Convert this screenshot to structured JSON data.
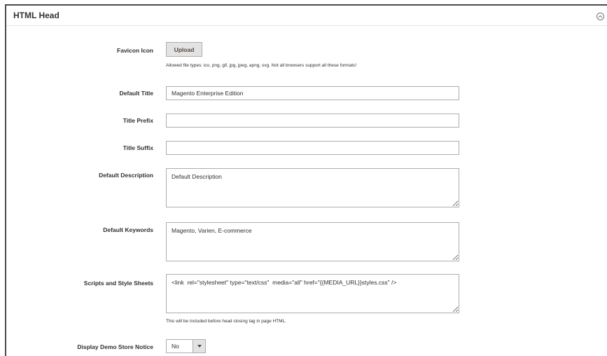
{
  "section": {
    "title": "HTML Head"
  },
  "favicon": {
    "label": "Favicon Icon",
    "button_label": "Upload",
    "note": "Allowed file types: ico, png, gif, jpg, jpeg, apng, svg. Not all browsers support all these formats!"
  },
  "default_title": {
    "label": "Default Title",
    "value": "Magento Enterprise Edition"
  },
  "title_prefix": {
    "label": "Title Prefix",
    "value": ""
  },
  "title_suffix": {
    "label": "Title Suffix",
    "value": ""
  },
  "default_description": {
    "label": "Default Description",
    "value": "Default Description"
  },
  "default_keywords": {
    "label": "Default Keywords",
    "value": "Magento, Varien, E-commerce"
  },
  "scripts": {
    "label": "Scripts and Style Sheets",
    "value": "<link  rel=\"stylesheet\" type=\"text/css\"  media=\"all\" href=\"{{MEDIA_URL}}styles.css\" />",
    "note": "This will be included before head closing tag in page HTML."
  },
  "demo_notice": {
    "label": "Display Demo Store Notice",
    "selected": "No"
  },
  "icons": {
    "collapse": "collapse-icon",
    "dropdown": "chevron-down-icon"
  }
}
